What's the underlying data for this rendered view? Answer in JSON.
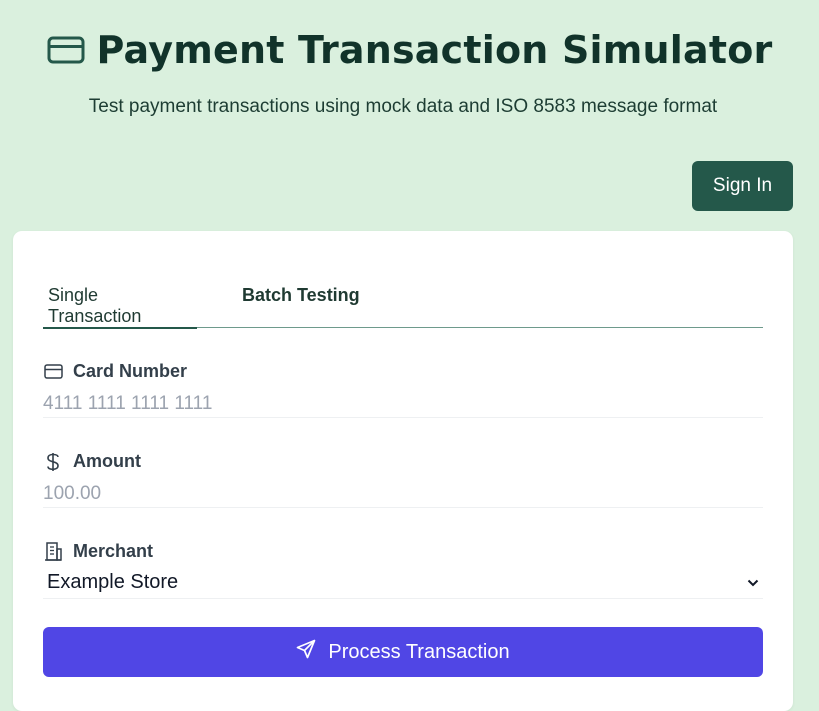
{
  "header": {
    "title": "Payment Transaction Simulator",
    "subtitle": "Test payment transactions using mock data and ISO 8583 message format",
    "icon": "credit-card-icon"
  },
  "auth": {
    "sign_in_label": "Sign In"
  },
  "tabs": [
    {
      "label": "Single Transaction",
      "active": true
    },
    {
      "label": "Batch Testing",
      "active": false
    }
  ],
  "form": {
    "card_number": {
      "label": "Card Number",
      "icon": "credit-card-icon",
      "value": "",
      "placeholder": "4111 1111 1111 1111"
    },
    "amount": {
      "label": "Amount",
      "icon": "dollar-icon",
      "value": "",
      "placeholder": "100.00"
    },
    "merchant": {
      "label": "Merchant",
      "icon": "building-icon",
      "selected": "Example Store"
    },
    "submit_label": "Process Transaction",
    "submit_icon": "send-icon"
  },
  "colors": {
    "background": "#daf0de",
    "primary_dark": "#24584a",
    "accent": "#5046e5",
    "title": "#11332a"
  }
}
